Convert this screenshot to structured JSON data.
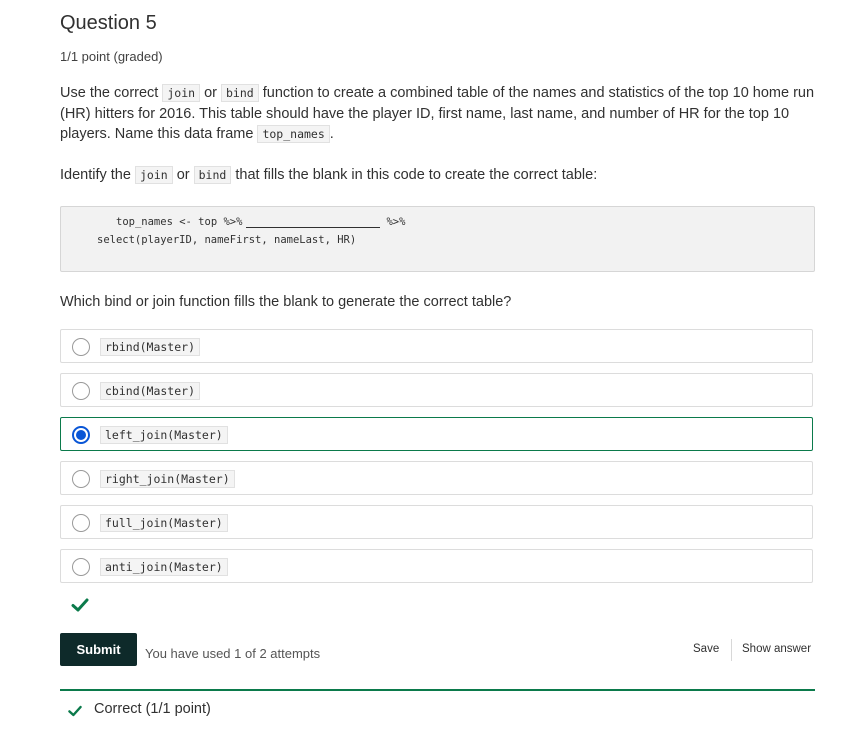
{
  "question": {
    "title": "Question 5",
    "points": "1/1 point (graded)"
  },
  "paragraph1": {
    "t1": "Use the correct ",
    "c1": "join",
    "t2": " or ",
    "c2": "bind",
    "t3": " function to create a combined table of the names and statistics of the top 10 home run (HR) hitters for 2016. This table should have the player ID, first name, last name, and number of HR for the top 10 players. Name this data frame ",
    "c3": "top_names",
    "t4": "."
  },
  "paragraph2": {
    "t1": "Identify the ",
    "c1": "join",
    "t2": " or ",
    "c2": "bind",
    "t3": " that fills the blank in this code to create the correct table:"
  },
  "code": {
    "line1_start": "top_names <- top %>%",
    "line1_end": "%>%",
    "line2": "select(playerID, nameFirst, nameLast, HR)"
  },
  "prompt": "Which bind or join function fills the blank to generate the correct table?",
  "options": [
    {
      "label": "rbind(Master)",
      "selected": false
    },
    {
      "label": "cbind(Master)",
      "selected": false
    },
    {
      "label": "left_join(Master)",
      "selected": true
    },
    {
      "label": "right_join(Master)",
      "selected": false
    },
    {
      "label": "full_join(Master)",
      "selected": false
    },
    {
      "label": "anti_join(Master)",
      "selected": false
    }
  ],
  "actions": {
    "submit": "Submit",
    "attempts": "You have used 1 of 2 attempts",
    "save": "Save",
    "show_answer": "Show answer"
  },
  "feedback": {
    "text": "Correct (1/1 point)"
  },
  "colors": {
    "accent": "#0b7a4b",
    "radio": "#0a56d6",
    "submit_bg": "#0e2a2a"
  },
  "icons": {
    "check": "check-icon",
    "radio_selected": "radio-selected-icon"
  }
}
